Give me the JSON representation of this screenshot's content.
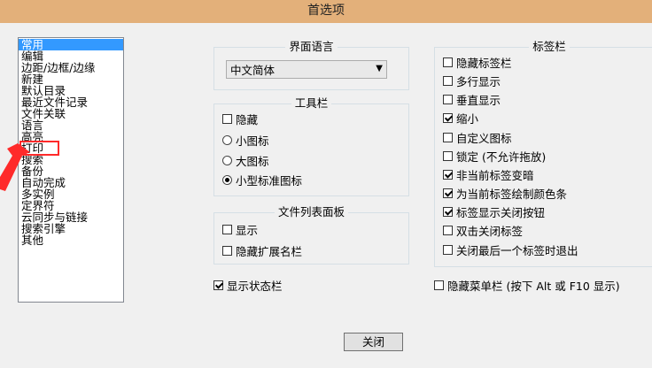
{
  "window": {
    "title": "首选项"
  },
  "categories": [
    {
      "label": "常用",
      "selected": true
    },
    {
      "label": "编辑",
      "selected": false
    },
    {
      "label": "边距/边框/边缘",
      "selected": false
    },
    {
      "label": "新建",
      "selected": false
    },
    {
      "label": "默认目录",
      "selected": false
    },
    {
      "label": "最近文件记录",
      "selected": false
    },
    {
      "label": "文件关联",
      "selected": false
    },
    {
      "label": "语言",
      "selected": false
    },
    {
      "label": "高亮",
      "selected": false
    },
    {
      "label": "打印",
      "selected": false
    },
    {
      "label": "搜索",
      "selected": false
    },
    {
      "label": "备份",
      "selected": false
    },
    {
      "label": "自动完成",
      "selected": false
    },
    {
      "label": "多实例",
      "selected": false
    },
    {
      "label": "定界符",
      "selected": false
    },
    {
      "label": "云同步与链接",
      "selected": false
    },
    {
      "label": "搜索引擎",
      "selected": false
    },
    {
      "label": "其他",
      "selected": false
    }
  ],
  "language": {
    "legend": "界面语言",
    "selected": "中文简体"
  },
  "toolbar": {
    "legend": "工具栏",
    "hide": {
      "label": "隐藏",
      "checked": false
    },
    "small_icons": {
      "label": "小图标",
      "checked": false
    },
    "large_icons": {
      "label": "大图标",
      "checked": false
    },
    "small_standard_icons": {
      "label": "小型标准图标",
      "checked": true
    }
  },
  "doc_list": {
    "legend": "文件列表面板",
    "show": {
      "label": "显示",
      "checked": false
    },
    "hide_ext": {
      "label": "隐藏扩展名栏",
      "checked": false
    }
  },
  "statusbar": {
    "label": "显示状态栏",
    "checked": true
  },
  "tabbar": {
    "legend": "标签栏",
    "items": [
      {
        "label": "隐藏标签栏",
        "checked": false
      },
      {
        "label": "多行显示",
        "checked": false
      },
      {
        "label": "垂直显示",
        "checked": false
      },
      {
        "label": "缩小",
        "checked": true
      },
      {
        "label": "自定义图标",
        "checked": false
      },
      {
        "label": "锁定 (不允许拖放)",
        "checked": false
      },
      {
        "label": "非当前标签变暗",
        "checked": true
      },
      {
        "label": "为当前标签绘制颜色条",
        "checked": true
      },
      {
        "label": "标签显示关闭按钮",
        "checked": true
      },
      {
        "label": "双击关闭标签",
        "checked": false
      },
      {
        "label": "关闭最后一个标签时退出",
        "checked": false
      }
    ]
  },
  "menubar": {
    "label": "隐藏菜单栏 (按下 Alt 或 F10 显示)",
    "checked": false
  },
  "close_button": "关闭",
  "colors": {
    "selection": "#3399ff",
    "annotation": "#ff2a2a",
    "titlebar": "#e3b07a"
  }
}
